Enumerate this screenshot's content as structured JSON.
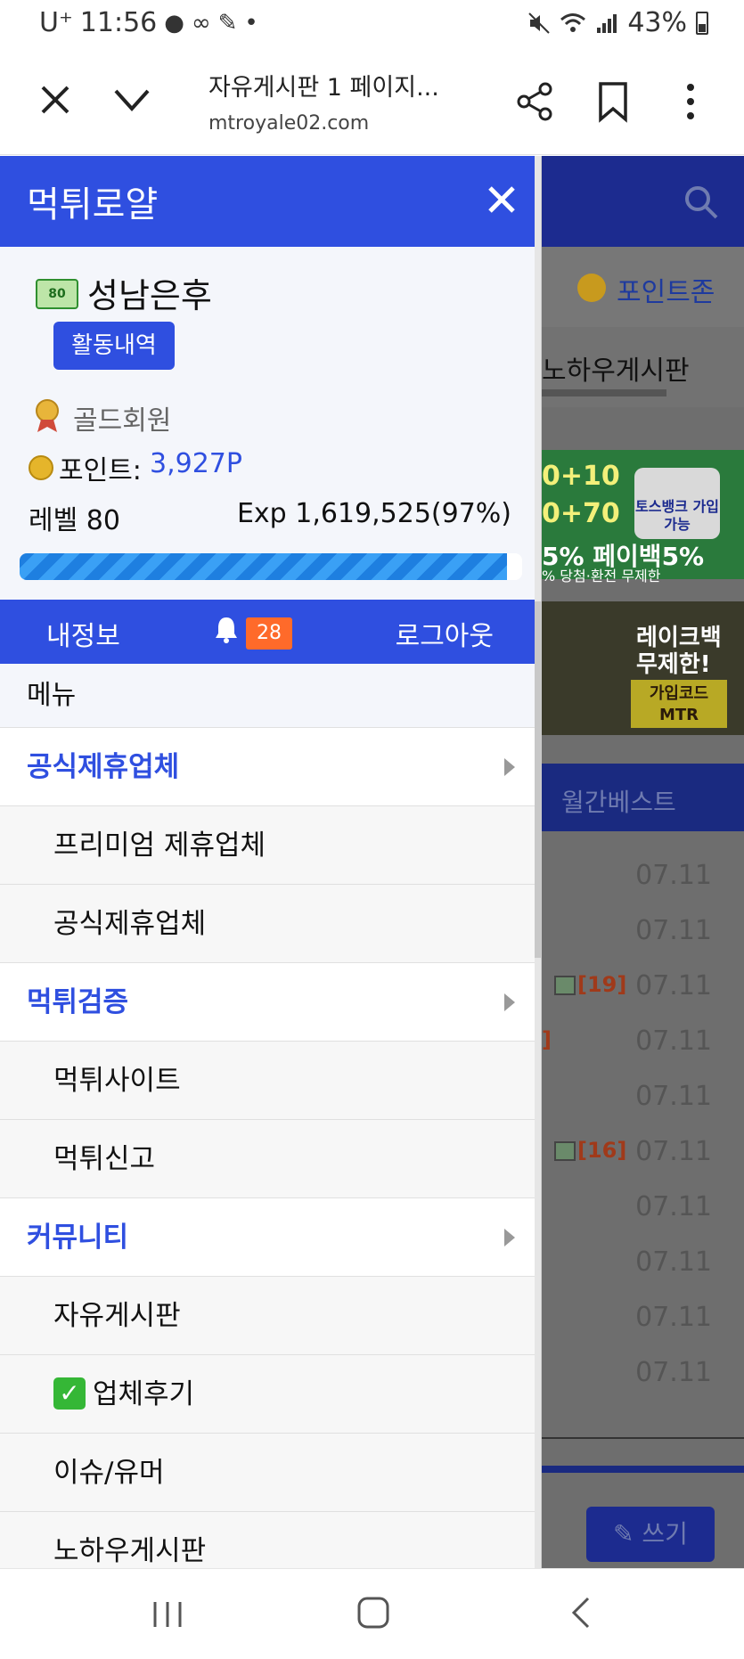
{
  "status": {
    "carrier": "U⁺",
    "time": "11:56",
    "battery": "43%",
    "icons": [
      "message-icon",
      "voicemail-icon",
      "app-icon",
      "dot-icon",
      "mute-icon",
      "wifi-icon",
      "signal-icon",
      "battery-icon"
    ]
  },
  "browser": {
    "title": "자유게시판 1 페이지...",
    "url": "mtroyale02.com"
  },
  "drawer": {
    "brand": "먹튀로얄",
    "user": {
      "level_badge": "80",
      "nickname": "성남은후",
      "activity_button": "활동내역",
      "grade": "골드회원",
      "points_label": "포인트:",
      "points_value": "3,927P",
      "level": "레벨 80",
      "exp": "Exp 1,619,525(97%)",
      "exp_fraction": 0.97
    },
    "user_bar": {
      "my_info": "내정보",
      "notification_count": "28",
      "logout": "로그아웃"
    },
    "menu": {
      "title": "메뉴",
      "cat1": "공식제휴업체",
      "cat1_items": [
        "프리미엄 제휴업체",
        "공식제휴업체"
      ],
      "cat2": "먹튀검증",
      "cat2_items": [
        "먹튀사이트",
        "먹튀신고"
      ],
      "cat3": "커뮤니티",
      "cat3_items": [
        "자유게시판",
        "업체후기",
        "이슈/유머",
        "노하우게시판"
      ],
      "check_mark": "✓"
    }
  },
  "background": {
    "point_zone": "포인트존",
    "knowhow": "노하우게시판",
    "banner1": {
      "line1": "0+10",
      "line2": "0+70",
      "line3": "5% 페이백5%",
      "line4": "% 당첨·환전 무제한",
      "toss": "토스뱅크 가입가능"
    },
    "banner2": {
      "line1": "레이크백",
      "line2": "무제한!",
      "code": "가입코드 MTR"
    },
    "tab": "월간베스트",
    "rows": [
      {
        "date": "07.11",
        "comment": ""
      },
      {
        "date": "07.11",
        "comment": ""
      },
      {
        "date": "07.11",
        "comment": "[19]"
      },
      {
        "date": "07.11",
        "comment": "]"
      },
      {
        "date": "07.11",
        "comment": ""
      },
      {
        "date": "07.11",
        "comment": "[16]"
      },
      {
        "date": "07.11",
        "comment": ""
      },
      {
        "date": "07.11",
        "comment": ""
      },
      {
        "date": "07.11",
        "comment": ""
      },
      {
        "date": "07.11",
        "comment": ""
      }
    ],
    "write_button": "쓰기"
  }
}
